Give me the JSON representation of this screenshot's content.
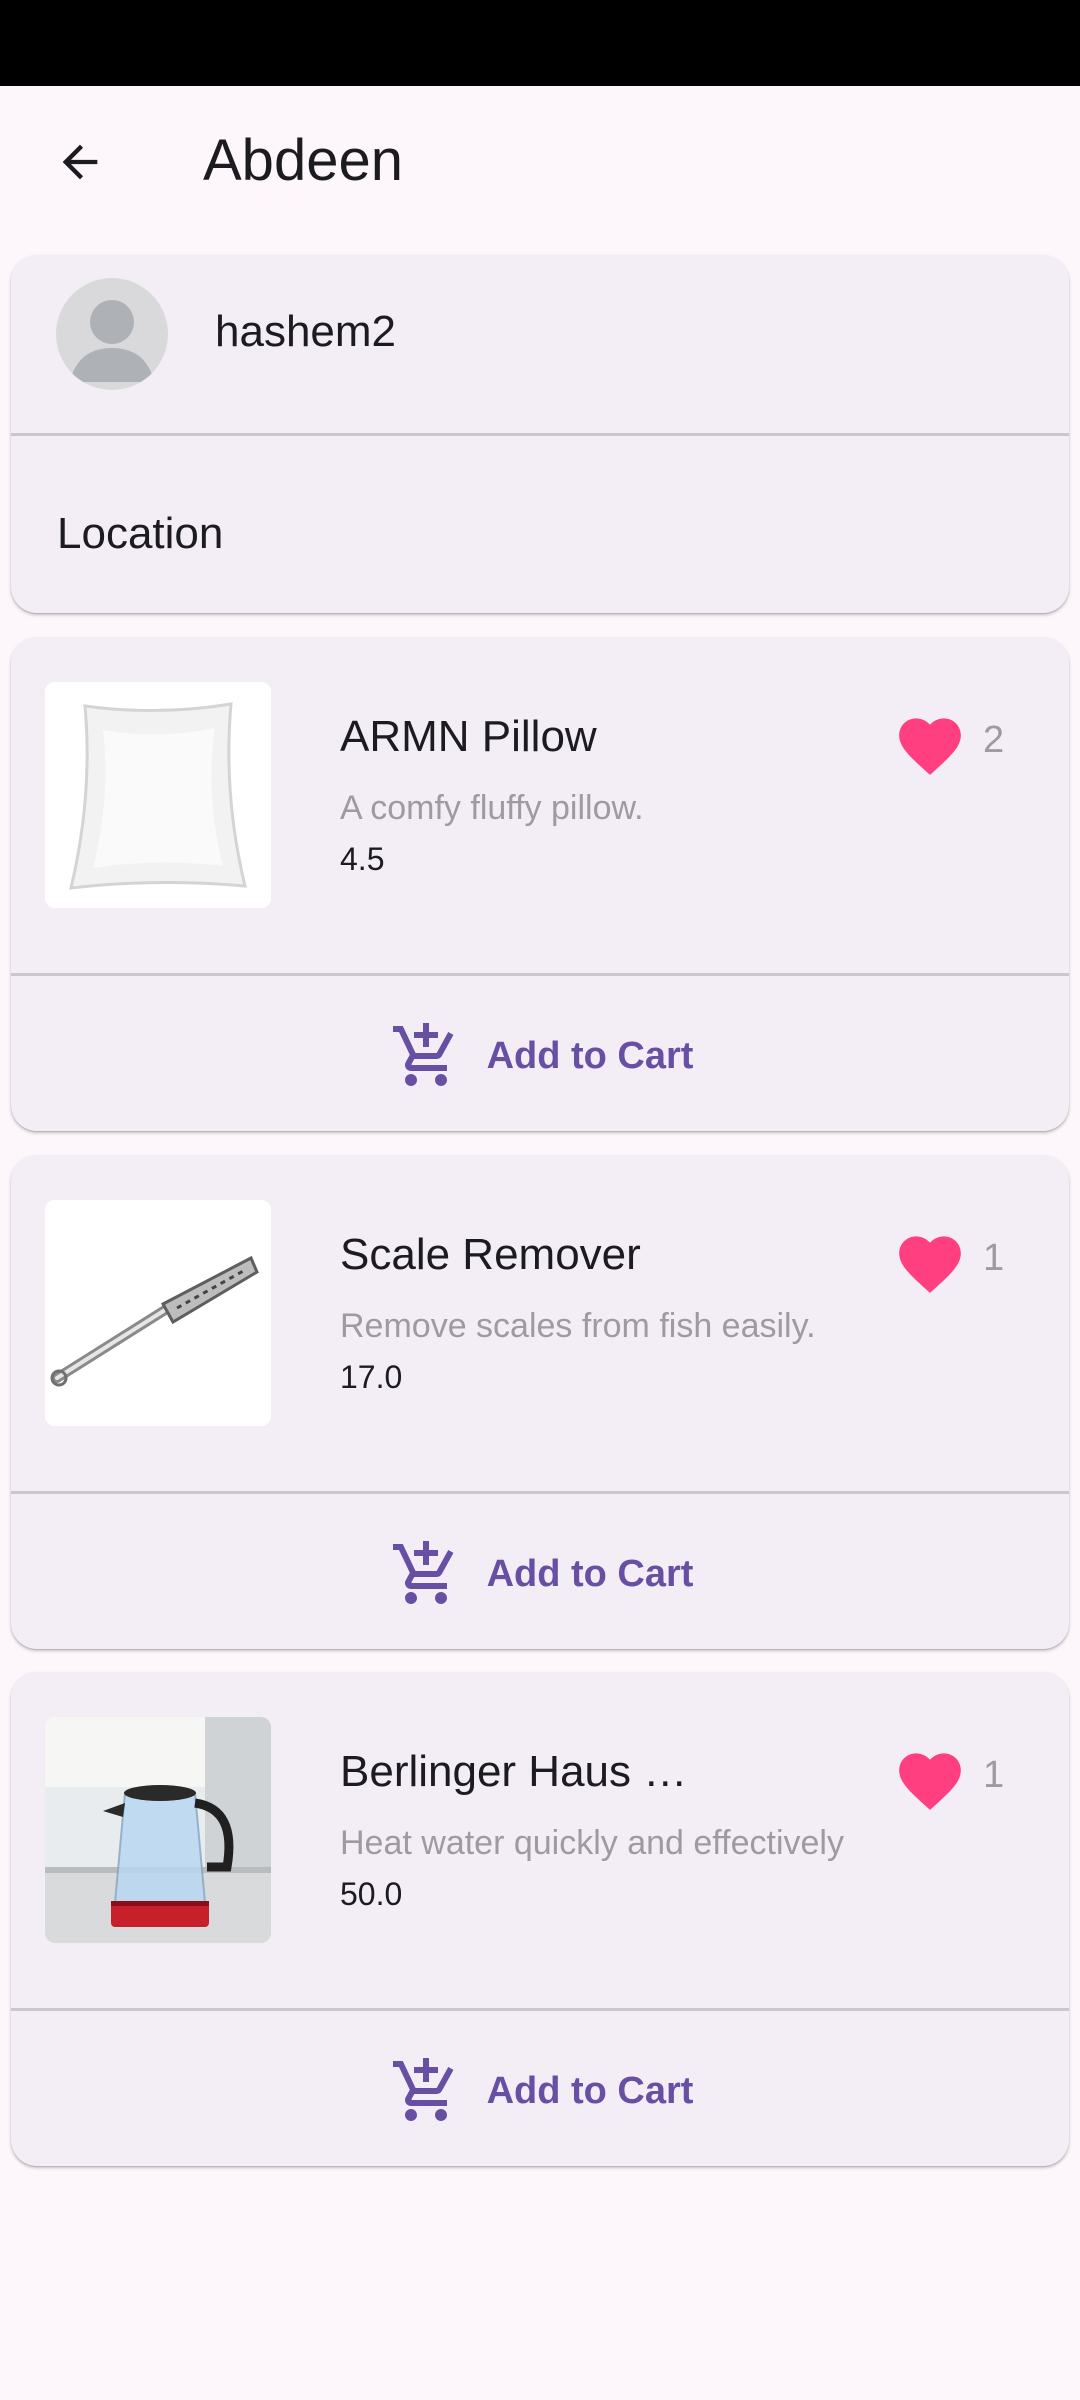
{
  "app_bar": {
    "title": "Abdeen",
    "back_icon": "arrow-back-icon"
  },
  "profile": {
    "username": "hashem2",
    "location_label": "Location",
    "avatar_icon": "person-avatar-icon"
  },
  "colors": {
    "accent": "#6750a4",
    "heart": "#ff3f7f",
    "card": "#f3eef6",
    "background": "#fdf7fc"
  },
  "products": [
    {
      "name": "ARMN Pillow",
      "description": "A comfy fluffy pillow.",
      "price": "4.5",
      "likes": "2",
      "cart_label": "Add to Cart",
      "image": "pillow"
    },
    {
      "name": "Scale Remover",
      "description": "Remove scales from fish easily.",
      "price": "17.0",
      "likes": "1",
      "cart_label": "Add to Cart",
      "image": "scale-remover"
    },
    {
      "name": "Berlinger Haus …",
      "description": "Heat water quickly and effectively",
      "price": "50.0",
      "likes": "1",
      "cart_label": "Add to Cart",
      "image": "kettle"
    }
  ]
}
